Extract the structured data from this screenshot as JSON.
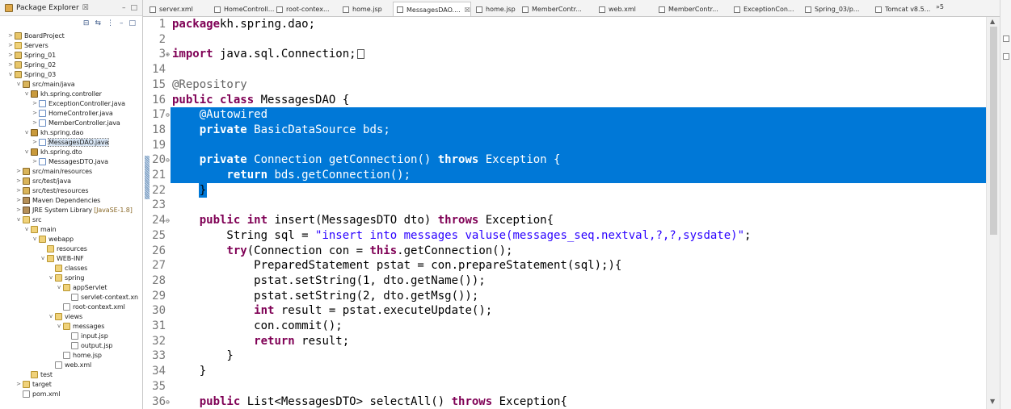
{
  "explorer": {
    "title": "Package Explorer",
    "title_suffix": "☒",
    "window_buttons": [
      "–",
      "□"
    ],
    "toolbar_icons": [
      "collapse-all-icon",
      "link-with-editor-icon",
      "view-menu-icon",
      "minimize-icon",
      "maximize-icon"
    ],
    "tree": [
      {
        "label": "BoardProject",
        "depth": 0,
        "twisty": ">",
        "icon": "project"
      },
      {
        "label": "Servers",
        "depth": 0,
        "twisty": ">",
        "icon": "folder"
      },
      {
        "label": "Spring_01",
        "depth": 0,
        "twisty": ">",
        "icon": "project"
      },
      {
        "label": "Spring_02",
        "depth": 0,
        "twisty": ">",
        "icon": "project"
      },
      {
        "label": "Spring_03",
        "depth": 0,
        "twisty": "v",
        "icon": "project"
      },
      {
        "label": "src/main/java",
        "depth": 1,
        "twisty": "v",
        "icon": "srcfolder"
      },
      {
        "label": "kh.spring.controller",
        "depth": 2,
        "twisty": "v",
        "icon": "package"
      },
      {
        "label": "ExceptionController.java",
        "depth": 3,
        "twisty": ">",
        "icon": "java"
      },
      {
        "label": "HomeController.java",
        "depth": 3,
        "twisty": ">",
        "icon": "java"
      },
      {
        "label": "MemberController.java",
        "depth": 3,
        "twisty": ">",
        "icon": "java"
      },
      {
        "label": "kh.spring.dao",
        "depth": 2,
        "twisty": "v",
        "icon": "package"
      },
      {
        "label": "MessagesDAO.java",
        "depth": 3,
        "twisty": ">",
        "icon": "java",
        "selected": true
      },
      {
        "label": "kh.spring.dto",
        "depth": 2,
        "twisty": "v",
        "icon": "package"
      },
      {
        "label": "MessagesDTO.java",
        "depth": 3,
        "twisty": ">",
        "icon": "java"
      },
      {
        "label": "src/main/resources",
        "depth": 1,
        "twisty": ">",
        "icon": "srcfolder"
      },
      {
        "label": "src/test/java",
        "depth": 1,
        "twisty": ">",
        "icon": "srcfolder"
      },
      {
        "label": "src/test/resources",
        "depth": 1,
        "twisty": ">",
        "icon": "srcfolder"
      },
      {
        "label": "Maven Dependencies",
        "depth": 1,
        "twisty": ">",
        "icon": "lib"
      },
      {
        "label": "JRE System Library",
        "suffix": "[JavaSE-1.8]",
        "depth": 1,
        "twisty": ">",
        "icon": "lib"
      },
      {
        "label": "src",
        "depth": 1,
        "twisty": "v",
        "icon": "folder"
      },
      {
        "label": "main",
        "depth": 2,
        "twisty": "v",
        "icon": "folder"
      },
      {
        "label": "webapp",
        "depth": 3,
        "twisty": "v",
        "icon": "folder"
      },
      {
        "label": "resources",
        "depth": 4,
        "twisty": "",
        "icon": "folder"
      },
      {
        "label": "WEB-INF",
        "depth": 4,
        "twisty": "v",
        "icon": "folder"
      },
      {
        "label": "classes",
        "depth": 5,
        "twisty": "",
        "icon": "folder"
      },
      {
        "label": "spring",
        "depth": 5,
        "twisty": "v",
        "icon": "folder"
      },
      {
        "label": "appServlet",
        "depth": 6,
        "twisty": "v",
        "icon": "folder"
      },
      {
        "label": "servlet-context.xn",
        "depth": 7,
        "twisty": "",
        "icon": "file"
      },
      {
        "label": "root-context.xml",
        "depth": 6,
        "twisty": "",
        "icon": "file"
      },
      {
        "label": "views",
        "depth": 5,
        "twisty": "v",
        "icon": "folder"
      },
      {
        "label": "messages",
        "depth": 6,
        "twisty": "v",
        "icon": "folder"
      },
      {
        "label": "input.jsp",
        "depth": 7,
        "twisty": "",
        "icon": "file"
      },
      {
        "label": "output.jsp",
        "depth": 7,
        "twisty": "",
        "icon": "file"
      },
      {
        "label": "home.jsp",
        "depth": 6,
        "twisty": "",
        "icon": "file"
      },
      {
        "label": "web.xml",
        "depth": 5,
        "twisty": "",
        "icon": "file"
      },
      {
        "label": "test",
        "depth": 2,
        "twisty": "",
        "icon": "folder"
      },
      {
        "label": "target",
        "depth": 1,
        "twisty": ">",
        "icon": "folder"
      },
      {
        "label": "pom.xml",
        "depth": 1,
        "twisty": "",
        "icon": "file"
      }
    ]
  },
  "tabs": [
    {
      "label": "server.xml",
      "active": false
    },
    {
      "label": "HomeControll...",
      "active": false
    },
    {
      "label": "root-contex...",
      "active": false
    },
    {
      "label": "home.jsp",
      "active": false
    },
    {
      "label": "MessagesDAO....",
      "active": true,
      "close": "☒"
    },
    {
      "label": "home.jsp",
      "active": false
    },
    {
      "label": "MemberContr...",
      "active": false
    },
    {
      "label": "web.xml",
      "active": false
    },
    {
      "label": "MemberContr...",
      "active": false
    },
    {
      "label": "ExceptionCon...",
      "active": false
    },
    {
      "label": "Spring_03/p...",
      "active": false
    },
    {
      "label": "Tomcat v8.5...",
      "active": false
    }
  ],
  "tab_overflow": "»5",
  "editor": {
    "lines": [
      {
        "num": "1",
        "fold": "",
        "sel": false,
        "tokens": [
          [
            "kw",
            "package"
          ],
          [
            "",
            "kh.spring.dao;"
          ]
        ]
      },
      {
        "num": "2",
        "fold": "",
        "sel": false,
        "tokens": []
      },
      {
        "num": "3",
        "fold": "⊕",
        "sel": false,
        "tokens": [
          [
            "kw",
            "import"
          ],
          [
            "",
            " java.sql.Connection;"
          ]
        ],
        "collapsed": true
      },
      {
        "num": "14",
        "fold": "",
        "sel": false,
        "tokens": []
      },
      {
        "num": "15",
        "fold": "",
        "sel": false,
        "tokens": [
          [
            "ann",
            "@Repository"
          ]
        ]
      },
      {
        "num": "16",
        "fold": "",
        "sel": false,
        "tokens": [
          [
            "kw",
            "public class"
          ],
          [
            "",
            " MessagesDAO {"
          ]
        ]
      },
      {
        "num": "17",
        "fold": "⊖",
        "sel": true,
        "tokens": [
          [
            "",
            "    "
          ],
          [
            "ann",
            "@Autowired"
          ]
        ]
      },
      {
        "num": "18",
        "fold": "",
        "sel": true,
        "tokens": [
          [
            "",
            "    "
          ],
          [
            "kw",
            "private"
          ],
          [
            "",
            " BasicDataSource "
          ],
          [
            "fld",
            "bds"
          ],
          [
            "",
            ";"
          ]
        ]
      },
      {
        "num": "19",
        "fold": "",
        "sel": true,
        "tokens": [
          [
            "",
            ""
          ]
        ]
      },
      {
        "num": "20",
        "fold": "⊖",
        "sel": true,
        "tokens": [
          [
            "",
            "    "
          ],
          [
            "kw",
            "private"
          ],
          [
            "",
            " Connection getConnection() "
          ],
          [
            "kw",
            "throws"
          ],
          [
            "",
            " Exception {"
          ]
        ]
      },
      {
        "num": "21",
        "fold": "",
        "sel": true,
        "tokens": [
          [
            "",
            "        "
          ],
          [
            "kw",
            "return"
          ],
          [
            "",
            " "
          ],
          [
            "fld",
            "bds"
          ],
          [
            "",
            ".getConnection();"
          ]
        ]
      },
      {
        "num": "22",
        "fold": "",
        "sel": true,
        "partial": true,
        "tokens": [
          [
            "",
            "    }"
          ]
        ]
      },
      {
        "num": "23",
        "fold": "",
        "sel": false,
        "tokens": []
      },
      {
        "num": "24",
        "fold": "⊖",
        "sel": false,
        "tokens": [
          [
            "",
            "    "
          ],
          [
            "kw",
            "public int"
          ],
          [
            "",
            " insert(MessagesDTO dto) "
          ],
          [
            "kw",
            "throws"
          ],
          [
            "",
            " Exception{"
          ]
        ]
      },
      {
        "num": "25",
        "fold": "",
        "sel": false,
        "tokens": [
          [
            "",
            "        String sql = "
          ],
          [
            "str",
            "\"insert into messages valuse(messages_seq.nextval,?,?,sysdate)\""
          ],
          [
            "",
            ";"
          ]
        ]
      },
      {
        "num": "26",
        "fold": "",
        "sel": false,
        "tokens": [
          [
            "",
            "        "
          ],
          [
            "kw",
            "try"
          ],
          [
            "",
            "(Connection con = "
          ],
          [
            "kw",
            "this"
          ],
          [
            "",
            ".getConnection();"
          ]
        ]
      },
      {
        "num": "27",
        "fold": "",
        "sel": false,
        "tokens": [
          [
            "",
            "            PreparedStatement pstat = con.prepareStatement(sql);){"
          ]
        ]
      },
      {
        "num": "28",
        "fold": "",
        "sel": false,
        "tokens": [
          [
            "",
            "            pstat.setString(1, dto.getName());"
          ]
        ]
      },
      {
        "num": "29",
        "fold": "",
        "sel": false,
        "tokens": [
          [
            "",
            "            pstat.setString(2, dto.getMsg());"
          ]
        ]
      },
      {
        "num": "30",
        "fold": "",
        "sel": false,
        "tokens": [
          [
            "",
            "            "
          ],
          [
            "kw",
            "int"
          ],
          [
            "",
            " result = pstat.executeUpdate();"
          ]
        ]
      },
      {
        "num": "31",
        "fold": "",
        "sel": false,
        "tokens": [
          [
            "",
            "            con.commit();"
          ]
        ]
      },
      {
        "num": "32",
        "fold": "",
        "sel": false,
        "tokens": [
          [
            "",
            "            "
          ],
          [
            "kw",
            "return"
          ],
          [
            "",
            " result;"
          ]
        ]
      },
      {
        "num": "33",
        "fold": "",
        "sel": false,
        "tokens": [
          [
            "",
            "        }"
          ]
        ]
      },
      {
        "num": "34",
        "fold": "",
        "sel": false,
        "tokens": [
          [
            "",
            "    }"
          ]
        ]
      },
      {
        "num": "35",
        "fold": "",
        "sel": false,
        "tokens": []
      },
      {
        "num": "36",
        "fold": "⊖",
        "sel": false,
        "tokens": [
          [
            "",
            "    "
          ],
          [
            "kw",
            "public"
          ],
          [
            "",
            " List<MessagesDTO> selectAll() "
          ],
          [
            "kw",
            "throws"
          ],
          [
            "",
            " Exception{"
          ]
        ]
      }
    ]
  },
  "colors": {
    "selection": "#0078d7",
    "keyword": "#7f0055",
    "string": "#2a00ff",
    "annotation": "#646464",
    "field": "#0000c0"
  }
}
